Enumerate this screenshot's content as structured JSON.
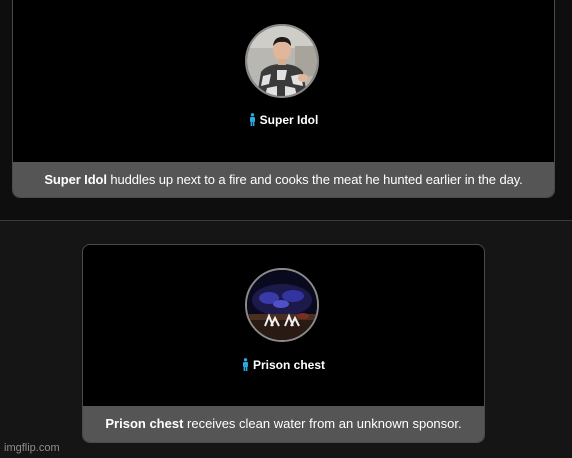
{
  "tributes": [
    {
      "name": "Super Idol",
      "caption_rest": " huddles up next to a fire and cooks the meat he hunted earlier in the day."
    },
    {
      "name": "Prison chest",
      "caption_rest": " receives clean water from an unknown sponsor."
    }
  ],
  "colors": {
    "person_icon": "#29a9e0",
    "caption_bar": "#555555",
    "card_background": "#000000"
  },
  "icons": [
    "person-icon"
  ],
  "watermark": "imgflip.com"
}
